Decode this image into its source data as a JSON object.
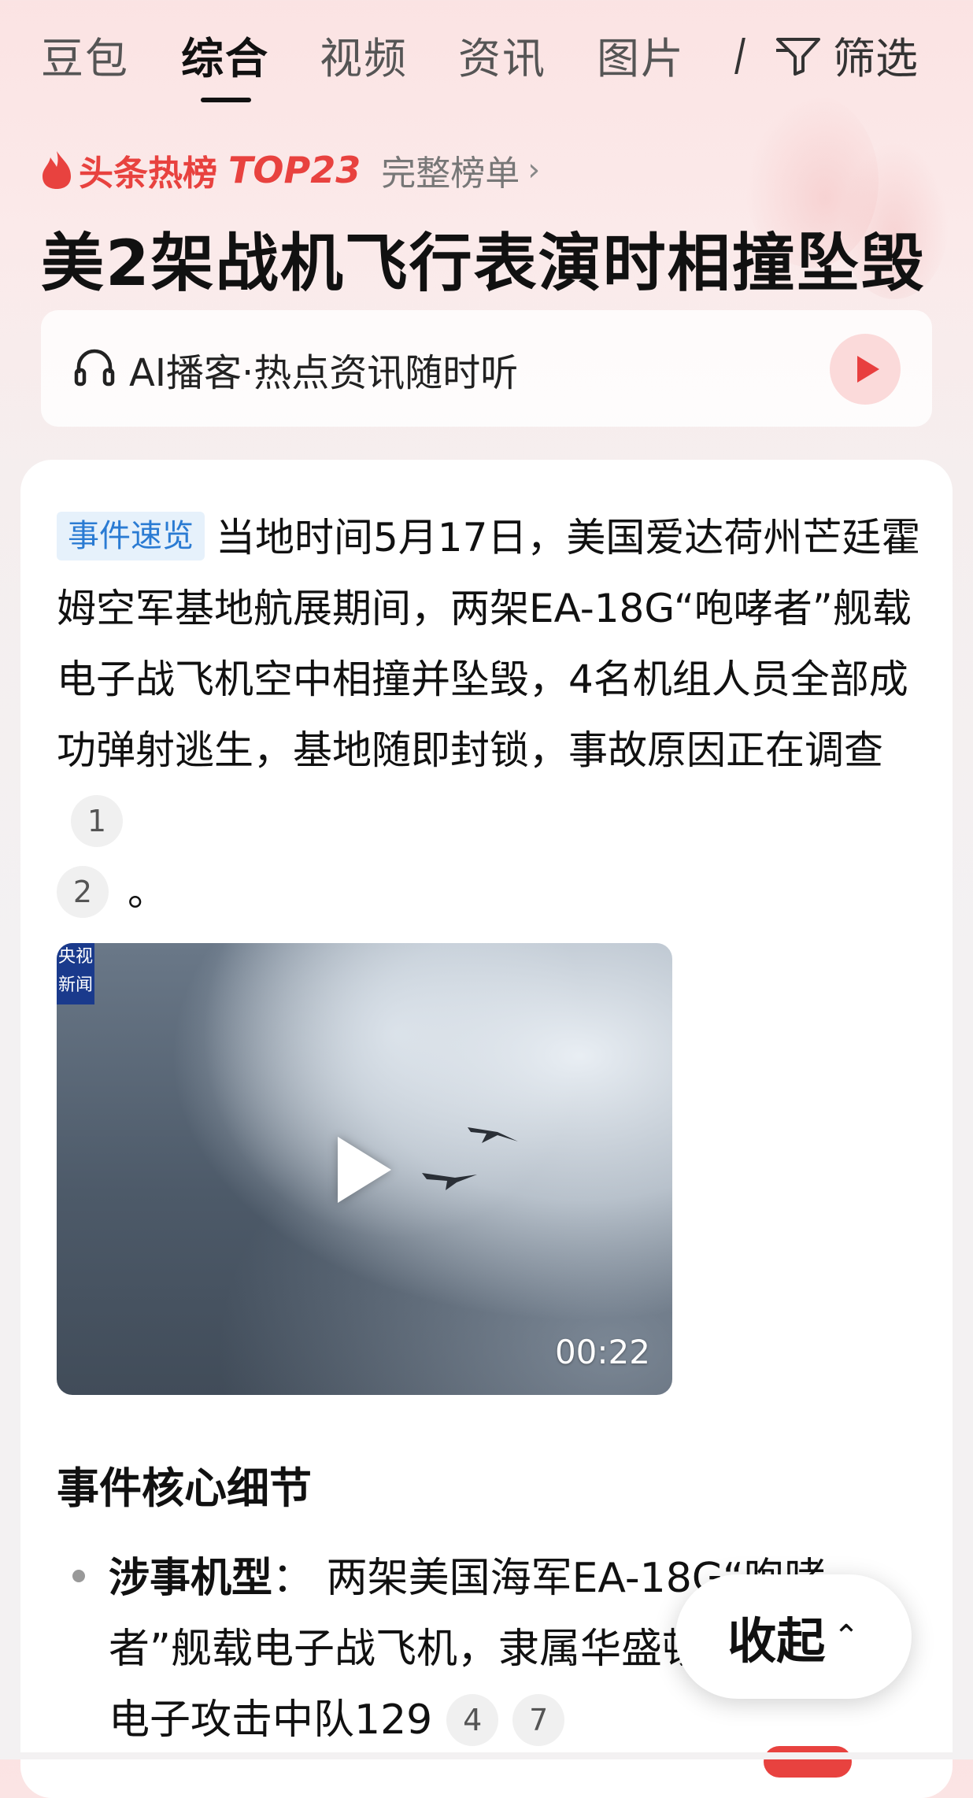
{
  "tabs": [
    {
      "label": "豆包",
      "active": false
    },
    {
      "label": "综合",
      "active": true
    },
    {
      "label": "视频",
      "active": false
    },
    {
      "label": "资讯",
      "active": false
    },
    {
      "label": "图片",
      "active": false
    }
  ],
  "filter_label": "筛选",
  "hot": {
    "label": "头条热榜",
    "rank": "TOP23",
    "more": "完整榜单"
  },
  "headline": "美2架战机飞行表演时相撞坠毁",
  "ai_bar": {
    "text": "AI播客·热点资讯随时听"
  },
  "summary": {
    "badge": "事件速览",
    "text": "当地时间5月17日，美国爱达荷州芒廷霍姆空军基地航展期间，两架EA-18G“咆哮者”舰载电子战飞机空中相撞并坠毁，4名机组人员全部成功弹射逃生，基地随即封锁，事故原因正在调查",
    "citations": [
      "1",
      "2"
    ],
    "end": "。"
  },
  "video": {
    "logo": "央视新闻",
    "duration": "00:22"
  },
  "section_title": "事件核心细节",
  "details": [
    {
      "label": "涉事机型",
      "colon": "：",
      "text": "两架美国海军EA-18G“咆哮者”舰载电子战飞机，隶属华盛顿州惠德贝岛电子攻击中队129",
      "citations": [
        "4",
        "7"
      ]
    }
  ],
  "collapse_label": "收起",
  "colors": {
    "accent_red": "#e8423f",
    "badge_blue": "#2a7bd3",
    "badge_bg": "#e6f1fb"
  }
}
